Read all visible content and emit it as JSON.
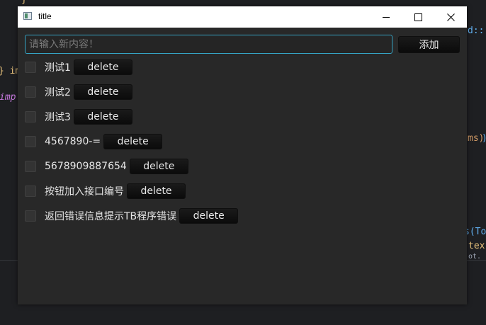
{
  "window": {
    "title": "title"
  },
  "background": {
    "fragments": [
      {
        "text": "}",
        "color": "#e6c07b"
      },
      {
        "text": "} im",
        "color": "#e6c07b"
      },
      {
        "text": "imp",
        "color": "#c678dd"
      },
      {
        "text": "d::",
        "color": "#61afef"
      },
      {
        "text": "ms)",
        "color": "#d19a66"
      },
      {
        "text": ")",
        "color": "#61afef"
      },
      {
        "text": "s(To",
        "color": "#61afef"
      },
      {
        "text": "tex",
        "color": "#e6c07b"
      },
      {
        "text": "ot.",
        "color": "#9da5b4"
      }
    ]
  },
  "input": {
    "placeholder": "请输入新内容！",
    "value": ""
  },
  "add_button": {
    "label": "添加"
  },
  "items": [
    {
      "text": "测试1",
      "checked": false,
      "delete_label": "delete"
    },
    {
      "text": "测试2",
      "checked": false,
      "delete_label": "delete"
    },
    {
      "text": "测试3",
      "checked": false,
      "delete_label": "delete"
    },
    {
      "text": "4567890-=",
      "checked": false,
      "delete_label": "delete"
    },
    {
      "text": "5678909887654",
      "checked": false,
      "delete_label": "delete"
    },
    {
      "text": "按钮加入接口编号",
      "checked": false,
      "delete_label": "delete"
    },
    {
      "text": "返回错误信息提示TB程序错误",
      "checked": false,
      "delete_label": "delete"
    }
  ]
}
